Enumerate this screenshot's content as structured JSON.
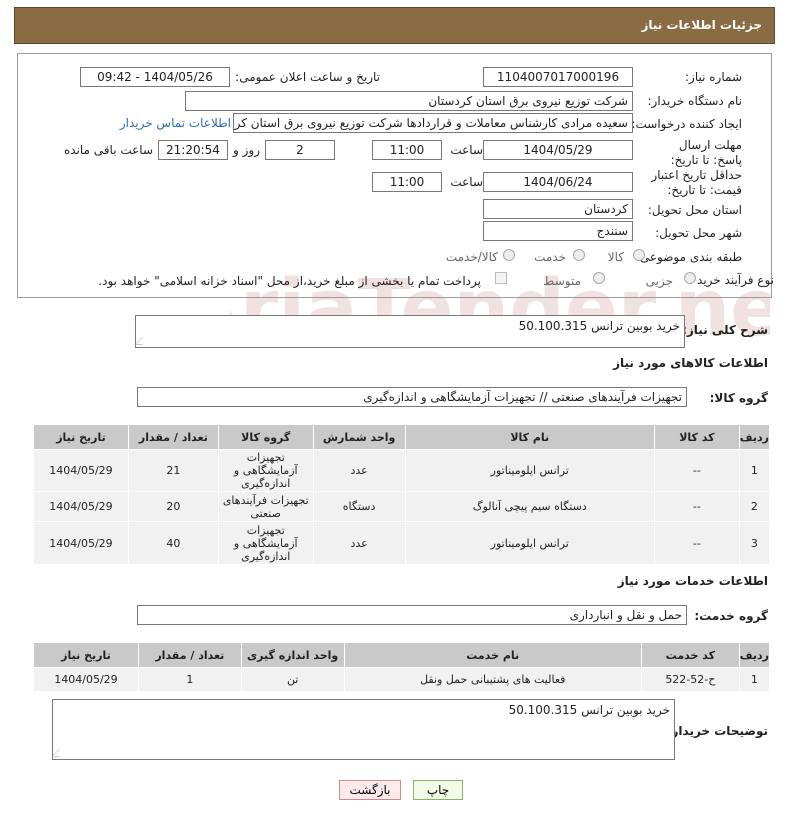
{
  "header": {
    "title": "جزئیات اطلاعات نیاز"
  },
  "form": {
    "need_number_label": "شماره نیاز:",
    "need_number": "1104007017000196",
    "announce_label": "تاریخ و ساعت اعلان عمومی:",
    "announce_value": "1404/05/26 - 09:42",
    "buyer_org_label": "نام دستگاه خریدار:",
    "buyer_org": "شرکت توزیع نیروی برق استان کردستان",
    "creator_label": "ایجاد کننده درخواست:",
    "creator": "سعیده مرادی کارشناس معاملات و قراردادها شرکت توزیع نیروی برق استان کردستان",
    "contact_link": "اطلاعات تماس خریدار",
    "reply_deadline_label": "مهلت ارسال پاسخ: تا تاریخ:",
    "reply_date": "1404/05/29",
    "time_label": "ساعت",
    "reply_time": "11:00",
    "days_value": "2",
    "days_label": "روز و",
    "remaining_time": "21:20:54",
    "remaining_label": "ساعت باقی مانده",
    "price_deadline_label": "حداقل تاریخ اعتبار قیمت: تا تاریخ:",
    "price_date": "1404/06/24",
    "price_time": "11:00",
    "province_label": "استان محل تحویل:",
    "province": "کردستان",
    "city_label": "شهر محل تحویل:",
    "city": "سنندج",
    "category_label": "طبقه بندی موضوعی:",
    "category_options": [
      "کالا",
      "خدمت",
      "کالا/خدمت"
    ],
    "process_label": "نوع فرآیند خرید :",
    "process_options": [
      "جزیی",
      "متوسط"
    ],
    "payment_note": "پرداخت تمام یا بخشی از مبلغ خرید،از محل \"اسناد خزانه اسلامی\" خواهد بود."
  },
  "description": {
    "label": "شرح کلی نیاز:",
    "value": "خرید بوبین ترانس 50.100.315"
  },
  "goods": {
    "section_title": "اطلاعات کالاهای مورد نیاز",
    "group_label": "گروه کالا:",
    "group_value": "تجهیزات فرآیندهای صنعتی // تجهیزات آزمایشگاهی و اندازه‌گیری",
    "columns": [
      "ردیف",
      "کد کالا",
      "نام کالا",
      "واحد شمارش",
      "گروه کالا",
      "تعداد / مقدار",
      "تاریخ نیاز"
    ],
    "rows": [
      [
        "1",
        "--",
        "ترانس ایلومیناتور",
        "عدد",
        "تجهیزات آزمایشگاهی و اندازه‌گیری",
        "21",
        "1404/05/29"
      ],
      [
        "2",
        "--",
        "دستگاه سیم پیچی آنالوگ",
        "دستگاه",
        "تجهیزات فرآیندهای صنعتی",
        "20",
        "1404/05/29"
      ],
      [
        "3",
        "--",
        "ترانس ایلومیناتور",
        "عدد",
        "تجهیزات آزمایشگاهی و اندازه‌گیری",
        "40",
        "1404/05/29"
      ]
    ]
  },
  "services": {
    "section_title": "اطلاعات خدمات مورد نیاز",
    "group_label": "گروه خدمت:",
    "group_value": "حمل و نقل و انبارداری",
    "columns": [
      "ردیف",
      "کد خدمت",
      "نام خدمت",
      "واحد اندازه گیری",
      "تعداد / مقدار",
      "تاریخ نیاز"
    ],
    "rows": [
      [
        "1",
        "ح-52-522",
        "فعالیت های پشتیبانی حمل ونقل",
        "تن",
        "1",
        "1404/05/29"
      ]
    ]
  },
  "buyer_notes": {
    "label": "توضیحات خریدار:",
    "value": "خرید بوبین ترانس 50.100.315"
  },
  "buttons": {
    "print": "چاپ",
    "back": "بازگشت"
  },
  "watermark": {
    "text": "AriaTender.net"
  },
  "colors": {
    "header_bg": "#8a6c44",
    "table_header_bg": "#c9c9c9",
    "link": "#2e6db0"
  }
}
